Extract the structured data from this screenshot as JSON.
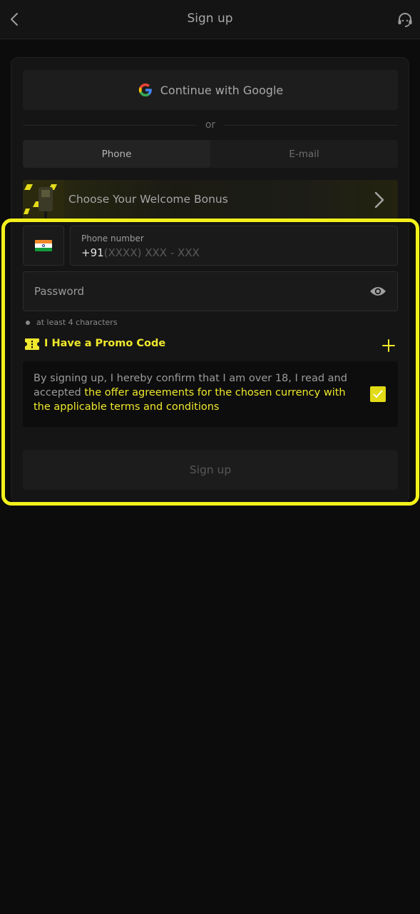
{
  "header": {
    "title": "Sign up",
    "back_icon": "chevron-left-icon",
    "support_icon": "headset-icon"
  },
  "google": {
    "label": "Continue with Google",
    "icon": "google-icon"
  },
  "divider": {
    "label": "or"
  },
  "tabs": [
    {
      "label": "Phone",
      "active": true
    },
    {
      "label": "E-mail",
      "active": false
    }
  ],
  "bonus": {
    "label": "Choose Your Welcome Bonus",
    "icon": "chevron-right-icon"
  },
  "phone": {
    "label": "Phone number",
    "prefix": "+91",
    "placeholder": "(XXXX) XXX - XXX",
    "country_icon": "india-flag-icon"
  },
  "password": {
    "placeholder": "Password",
    "icon": "eye-icon"
  },
  "hint": "at least 4 characters",
  "promo": {
    "label": "I Have a Promo Code",
    "icon": "ticket-icon",
    "add_icon": "plus-icon"
  },
  "consent": {
    "text": "By signing up, I hereby confirm that I am over 18, I read and accepted ",
    "link": "the offer agreements for the chosen currency with the applicable terms and conditions",
    "checked": true
  },
  "submit": {
    "label": "Sign up"
  },
  "colors": {
    "accent": "#efe82d",
    "background": "#0c0c0c",
    "card": "#151515"
  }
}
